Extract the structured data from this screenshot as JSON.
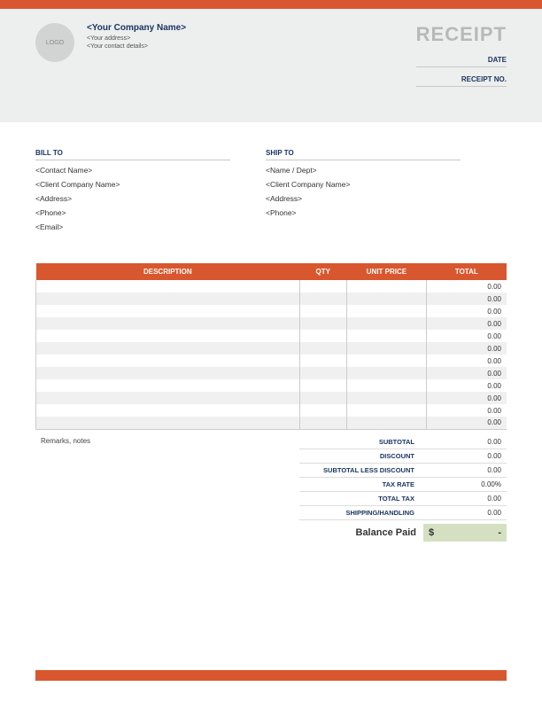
{
  "header": {
    "logo_text": "LOGO",
    "company_name": "<Your Company Name>",
    "address": "<Your address>",
    "contact": "<Your contact details>",
    "receipt_title": "RECEIPT",
    "date_label": "DATE",
    "receipt_no_label": "RECEIPT NO."
  },
  "bill_to": {
    "title": "BILL TO",
    "contact": "<Contact Name>",
    "company": "<Client Company Name>",
    "address": "<Address>",
    "phone": "<Phone>",
    "email": "<Email>"
  },
  "ship_to": {
    "title": "SHIP TO",
    "name": "<Name / Dept>",
    "company": "<Client Company Name>",
    "address": "<Address>",
    "phone": "<Phone>"
  },
  "table": {
    "headers": {
      "description": "DESCRIPTION",
      "qty": "QTY",
      "unit_price": "UNIT PRICE",
      "total": "TOTAL"
    },
    "rows": [
      {
        "total": "0.00"
      },
      {
        "total": "0.00"
      },
      {
        "total": "0.00"
      },
      {
        "total": "0.00"
      },
      {
        "total": "0.00"
      },
      {
        "total": "0.00"
      },
      {
        "total": "0.00"
      },
      {
        "total": "0.00"
      },
      {
        "total": "0.00"
      },
      {
        "total": "0.00"
      },
      {
        "total": "0.00"
      },
      {
        "total": "0.00"
      }
    ]
  },
  "remarks": "Remarks, notes",
  "summary": {
    "subtotal_label": "SUBTOTAL",
    "subtotal": "0.00",
    "discount_label": "DISCOUNT",
    "discount": "0.00",
    "subtotal_less_label": "SUBTOTAL LESS DISCOUNT",
    "subtotal_less": "0.00",
    "tax_rate_label": "TAX RATE",
    "tax_rate": "0.00%",
    "total_tax_label": "TOTAL TAX",
    "total_tax": "0.00",
    "shipping_label": "SHIPPING/HANDLING",
    "shipping": "0.00",
    "balance_label": "Balance Paid",
    "balance_currency": "$",
    "balance_value": "-"
  }
}
